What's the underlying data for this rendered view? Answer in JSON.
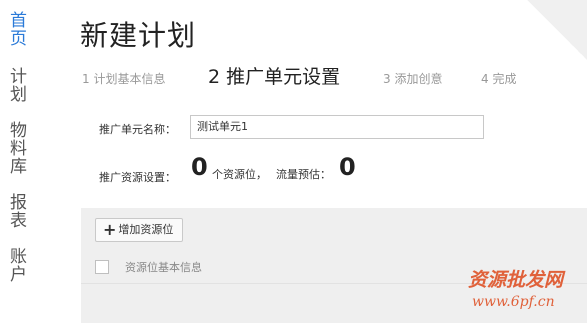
{
  "sidebar": {
    "items": [
      {
        "label": "首页"
      },
      {
        "label": "计划"
      },
      {
        "label": "物料库"
      },
      {
        "label": "报表"
      },
      {
        "label": "账户"
      }
    ]
  },
  "page": {
    "title": "新建计划"
  },
  "steps": [
    {
      "label": "1 计划基本信息"
    },
    {
      "label": "2 推广单元设置"
    },
    {
      "label": "3 添加创意"
    },
    {
      "label": "4 完成"
    }
  ],
  "form": {
    "unit_name_label": "推广单元名称：",
    "unit_name_value": "测试单元1",
    "resource_label": "推广资源设置：",
    "resource_count": "0",
    "resource_unit": "个资源位，",
    "traffic_label": "流量预估：",
    "traffic_value": "0"
  },
  "panel": {
    "add_button_label": "增加资源位",
    "column_header": "资源位基本信息"
  },
  "watermark": {
    "text": "资源批发网",
    "url": "www.6pf.cn"
  },
  "colors": {
    "accent": "#2a7ad8",
    "watermark": "#e0613a"
  }
}
